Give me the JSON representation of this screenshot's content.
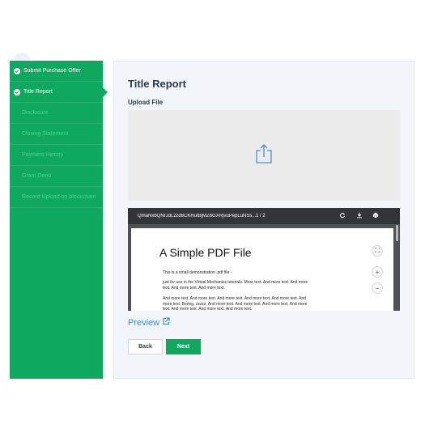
{
  "sidebar": {
    "steps": [
      {
        "label": "Submit Purchase Offer",
        "status": "completed"
      },
      {
        "label": "Title Report",
        "status": "active"
      },
      {
        "label": "Disclosure",
        "status": "pending"
      },
      {
        "label": "Closing Statement",
        "status": "pending"
      },
      {
        "label": "Payment History",
        "status": "pending"
      },
      {
        "label": "Grant Deed",
        "status": "pending"
      },
      {
        "label": "Record Upload on blockchain",
        "status": "pending"
      }
    ]
  },
  "main": {
    "title": "Title Report",
    "upload_label": "Upload File",
    "upload_icon": "upload-share-icon"
  },
  "viewer": {
    "filename": "QmaNxbQNrJdLzzd8CKRutBjMZ6GXRjvuPepLuNSs...",
    "pages": "1  /  2",
    "icons": [
      "rotate-icon",
      "download-icon",
      "print-icon"
    ],
    "doc_title": "A Simple PDF File",
    "paragraphs": [
      "This is a small demonstration .pdf file -",
      "just for use in the Virtual Mechanics tutorials. More text. And more text. And more text. And more text. And more text.",
      "And more text. And more text. And more text. And more text. And more text. And more text. Boring, zzzzz. And more text. And more text. And more text. And more text. And more text. And more text. And more text."
    ]
  },
  "actions": {
    "preview_label": "Preview",
    "back_label": "Back",
    "next_label": "Next"
  },
  "colors": {
    "brand_green": "#0ea85e",
    "link_blue": "#3f8dd1",
    "panel_bg": "#f2f6fa"
  }
}
